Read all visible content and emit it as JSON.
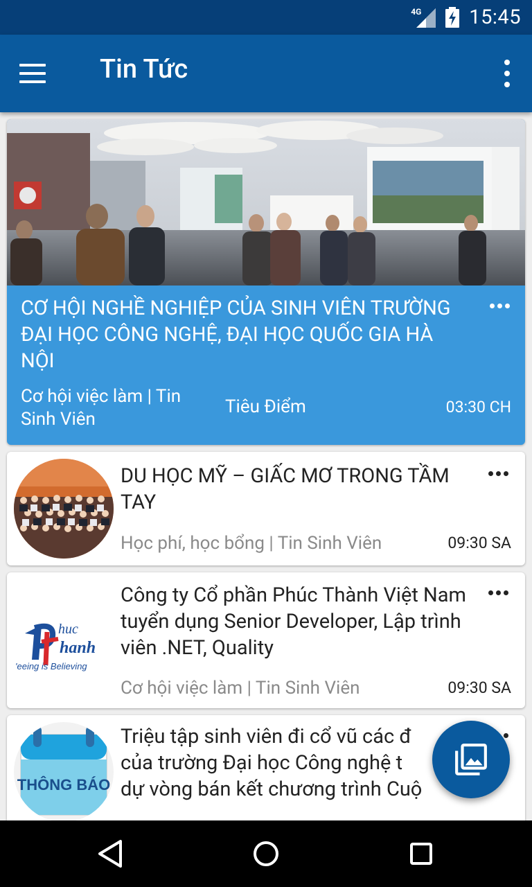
{
  "status_bar": {
    "network": "4G",
    "time": "15:45",
    "icons": [
      "signal-icon",
      "battery-charging-icon"
    ]
  },
  "app_bar": {
    "title": "Tin Tức",
    "menu_icon": "hamburger-menu-icon",
    "overflow_icon": "overflow-menu-icon"
  },
  "featured": {
    "headline": "CƠ HỘI NGHỀ NGHIỆP CỦA SINH VIÊN TRƯỜNG ĐẠI HỌC CÔNG NGHỆ, ĐẠI HỌC QUỐC GIA HÀ NỘI",
    "category": "Cơ hội việc làm | Tin Sinh Viên",
    "tag": "Tiêu Điểm",
    "time": "03:30 CH",
    "colors": {
      "card_bg": "#3a98dc"
    }
  },
  "articles": [
    {
      "title": "DU HỌC MỸ – GIẤC MƠ TRONG TẦM TAY",
      "meta": "Học phí, học bổng | Tin Sinh Viên",
      "time": "09:30 SA"
    },
    {
      "title": "Công ty Cổ phần Phúc Thành Việt Nam tuyển dụng Senior Developer, Lập trình viên .NET, Quality",
      "meta": "Cơ hội việc làm | Tin Sinh Viên",
      "time": "09:30 SA",
      "logo": {
        "word1": "huc",
        "word2": "hanh",
        "tagline": "'eeing is Believing"
      }
    },
    {
      "title": "Triệu tập sinh viên đi cổ vũ các đ... của trường Đại học Công nghệ t... dự  vòng bán kết chương trình Cuộ...",
      "title_lines": [
        "Triệu tập sinh viên đi cổ vũ các đ",
        "của trường Đại học Công nghệ t",
        "dự  vòng bán kết chương trình Cuộ"
      ],
      "thumb_text": "THÔNG BÁO"
    }
  ],
  "fab": {
    "icon": "photo-gallery-icon"
  },
  "nav_bar": {
    "back_icon": "back-triangle-icon",
    "home_icon": "home-circle-icon",
    "recents_icon": "recents-square-icon"
  },
  "colors": {
    "primary": "#0a5a9e",
    "primary_dark": "#063f78",
    "featured": "#3a98dc",
    "background": "#eeeeee"
  }
}
